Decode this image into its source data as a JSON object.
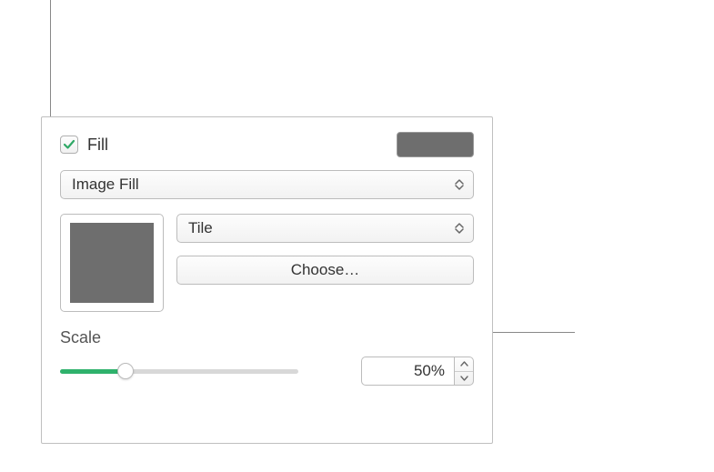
{
  "fill": {
    "checkbox_label": "Fill",
    "checked": true,
    "swatch_color": "#6e6e6e"
  },
  "fill_type_select": {
    "value": "Image Fill"
  },
  "display_mode_select": {
    "value": "Tile"
  },
  "choose_button": {
    "label": "Choose…"
  },
  "scale": {
    "label": "Scale",
    "value_display": "50%",
    "percent": 50
  }
}
